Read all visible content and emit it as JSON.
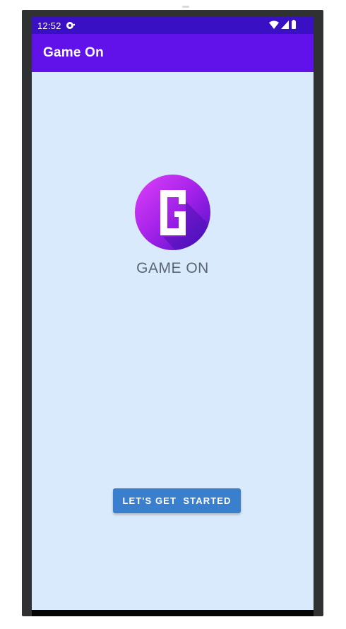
{
  "status_bar": {
    "time": "12:52",
    "notification_icon": "notification-bubble-icon",
    "right_icons": [
      "wifi-icon",
      "cell-signal-icon",
      "battery-icon"
    ]
  },
  "app_bar": {
    "title": "Game On"
  },
  "logo": {
    "letter": "G",
    "name": "GAME ON",
    "gradient_start": "#d63ef0",
    "gradient_end": "#5a12d8"
  },
  "button": {
    "label": "LET'S GET  STARTED"
  },
  "colors": {
    "status_bar": "#3a10c4",
    "app_bar": "#6112ea",
    "background": "#d9eafc",
    "button": "#3a7fce"
  }
}
